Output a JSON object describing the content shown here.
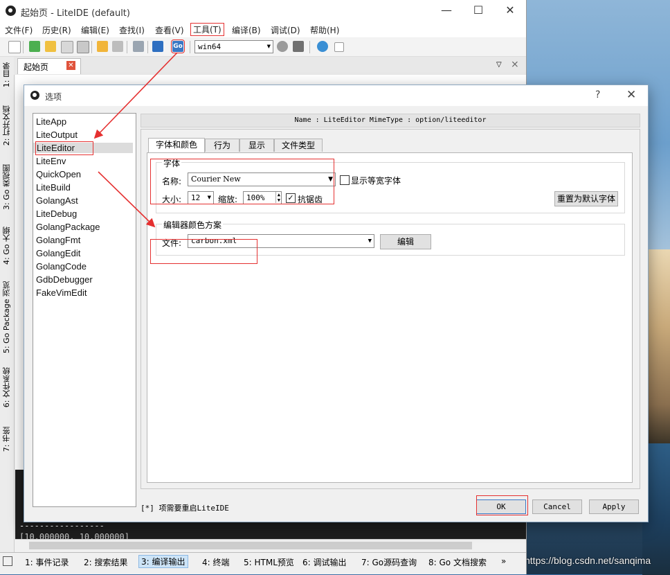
{
  "main_window": {
    "title": "起始页 - LiteIDE (default)",
    "controls": {
      "minimize": "—",
      "maximize": "☐",
      "close": "✕"
    },
    "menu": [
      "文件(F)",
      "历史(R)",
      "编辑(E)",
      "查找(I)",
      "查看(V)",
      "工具(T)",
      "编译(B)",
      "调试(D)",
      "帮助(H)"
    ],
    "toolbar": {
      "env_combo": "win64",
      "go_icon_label": "Go"
    },
    "tab": {
      "label": "起始页",
      "close": "✕"
    },
    "left_rail": [
      "1: 目录",
      "2: 打开文档",
      "3: Go 类视图",
      "4: Go 大纲",
      "5: Go Package 浏览",
      "6: 文件系统",
      "7: 书签"
    ],
    "bottom_tabs": [
      "1: 事件记录",
      "2: 搜索结果",
      "3: 编译输出",
      "4: 终端",
      "5: HTML预览",
      "6: 调试输出",
      "7: Go源码查询",
      "8: Go 文档搜索",
      "»"
    ],
    "bottom_active": 2,
    "console_lines": [
      "-----------------",
      "[10.000000, 10.000000]"
    ]
  },
  "dialog": {
    "title": "选项",
    "help": "?",
    "close": "✕",
    "nav_items": [
      "LiteApp",
      "LiteOutput",
      "LiteEditor",
      "LiteEnv",
      "QuickOpen",
      "LiteBuild",
      "GolangAst",
      "LiteDebug",
      "GolangPackage",
      "GolangFmt",
      "GolangEdit",
      "GolangCode",
      "GdbDebugger",
      "FakeVimEdit"
    ],
    "nav_selected": "LiteEditor",
    "info": "Name : LiteEditor    MimeType : option/liteeditor",
    "tabs": [
      "字体和颜色",
      "行为",
      "显示",
      "文件类型"
    ],
    "font_group": {
      "label": "字体",
      "name_label": "名称:",
      "name_value": "Courier New",
      "monospace_label": "显示等宽字体",
      "monospace_checked": false,
      "size_label": "大小:",
      "size_value": "12",
      "zoom_label": "缩放:",
      "zoom_value": "100%",
      "antialias_label": "抗锯齿",
      "antialias_checked": true,
      "reset_button": "重置为默认字体"
    },
    "color_group": {
      "label": "编辑器颜色方案",
      "file_label": "文件:",
      "file_value": "carbon.xml",
      "edit_button": "编辑"
    },
    "footnote": "[*] 项需要重启LiteIDE",
    "buttons": {
      "ok": "OK",
      "cancel": "Cancel",
      "apply": "Apply"
    }
  },
  "watermark": "https://blog.csdn.net/sanqima",
  "colors": {
    "annotation_red": "#e53030",
    "accent_blue": "#3a77c4"
  }
}
